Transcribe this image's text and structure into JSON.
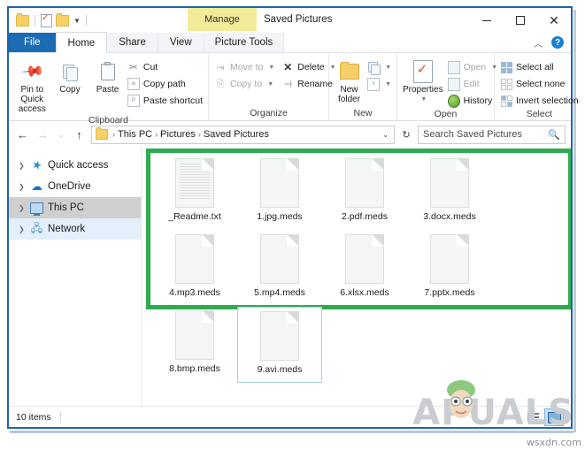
{
  "window": {
    "title": "Saved Pictures",
    "manage_tab": "Manage",
    "minimize_label": "—",
    "maximize_label": "□",
    "close_label": "✕",
    "collapse_ribbon_label": "︿",
    "help_label": "?"
  },
  "quick_access_toolbar": {
    "items": [
      "folder-icon",
      "properties-icon",
      "folder-icon",
      "chevron-down-icon"
    ]
  },
  "tabs": [
    {
      "label": "File",
      "type": "file"
    },
    {
      "label": "Home",
      "type": "active"
    },
    {
      "label": "Share",
      "type": "normal"
    },
    {
      "label": "View",
      "type": "normal"
    },
    {
      "label": "Picture Tools",
      "type": "context"
    }
  ],
  "ribbon": {
    "groups": [
      {
        "label": "Clipboard",
        "big_buttons": [
          {
            "label": "Pin to Quick access",
            "icon": "pin-icon"
          },
          {
            "label": "Copy",
            "icon": "copy-icon"
          },
          {
            "label": "Paste",
            "icon": "paste-icon"
          }
        ],
        "small_buttons": [
          {
            "label": "Cut",
            "icon": "scissors-icon",
            "dim": false
          },
          {
            "label": "Copy path",
            "icon": "copy-path-icon",
            "dim": false
          },
          {
            "label": "Paste shortcut",
            "icon": "paste-shortcut-icon",
            "dim": false
          }
        ]
      },
      {
        "label": "Organize",
        "small_buttons_a": [
          {
            "label": "Move to",
            "icon": "move-to-icon",
            "dim": true,
            "caret": true
          },
          {
            "label": "Copy to",
            "icon": "copy-to-icon",
            "dim": true,
            "caret": true
          }
        ],
        "small_buttons_b": [
          {
            "label": "Delete",
            "icon": "delete-icon",
            "dim": false,
            "caret": true
          },
          {
            "label": "Rename",
            "icon": "rename-icon",
            "dim": false,
            "caret": false
          }
        ]
      },
      {
        "label": "New",
        "big_buttons": [
          {
            "label": "New folder",
            "icon": "new-folder-icon"
          }
        ],
        "small_buttons": [
          {
            "label": "",
            "icon": "new-item-icon",
            "caret": true
          },
          {
            "label": "",
            "icon": "easy-access-icon",
            "caret": true
          }
        ]
      },
      {
        "label": "Open",
        "big_buttons": [
          {
            "label": "Properties",
            "icon": "properties-icon"
          }
        ],
        "small_buttons": [
          {
            "label": "Open",
            "icon": "open-icon",
            "dim": true,
            "caret": true
          },
          {
            "label": "Edit",
            "icon": "edit-icon",
            "dim": true,
            "caret": false
          },
          {
            "label": "History",
            "icon": "history-icon",
            "dim": false,
            "caret": false
          }
        ]
      },
      {
        "label": "Select",
        "small_buttons": [
          {
            "label": "Select all",
            "icon": "select-all-icon",
            "dim": false
          },
          {
            "label": "Select none",
            "icon": "select-none-icon",
            "dim": false
          },
          {
            "label": "Invert selection",
            "icon": "invert-selection-icon",
            "dim": false
          }
        ]
      }
    ]
  },
  "addressbar": {
    "back_label": "←",
    "forward_label": "→",
    "recent_label": "⌄",
    "up_label": "↑",
    "breadcrumbs": [
      "This PC",
      "Pictures",
      "Saved Pictures"
    ],
    "separator": "›",
    "dropdown_label": "⌄",
    "refresh_label": "↻",
    "search_placeholder": "Search Saved Pictures",
    "search_value": "",
    "search_icon": "🔍"
  },
  "sidebar": {
    "items": [
      {
        "label": "Quick access",
        "icon": "star-icon",
        "state": "normal"
      },
      {
        "label": "OneDrive",
        "icon": "cloud-icon",
        "state": "normal"
      },
      {
        "label": "This PC",
        "icon": "computer-icon",
        "state": "selected"
      },
      {
        "label": "Network",
        "icon": "network-icon",
        "state": "hover"
      }
    ],
    "expand_chevron": "›"
  },
  "files": [
    {
      "name": "_Readme.txt",
      "type": "text",
      "selected": false
    },
    {
      "name": "1.jpg.meds",
      "type": "blank",
      "selected": false
    },
    {
      "name": "2.pdf.meds",
      "type": "blank",
      "selected": false
    },
    {
      "name": "3.docx.meds",
      "type": "blank",
      "selected": false
    },
    {
      "name": "4.mp3.meds",
      "type": "blank",
      "selected": false
    },
    {
      "name": "5.mp4.meds",
      "type": "blank",
      "selected": false
    },
    {
      "name": "6.xlsx.meds",
      "type": "blank",
      "selected": false
    },
    {
      "name": "7.pptx.meds",
      "type": "blank",
      "selected": false
    },
    {
      "name": "8.bmp.meds",
      "type": "blank",
      "selected": false
    },
    {
      "name": "9.avi.meds",
      "type": "blank",
      "selected": true
    }
  ],
  "statusbar": {
    "item_count": "10 items",
    "view_details_icon": "details-view-icon",
    "view_icons_icon": "large-icons-view-icon"
  },
  "highlight": {
    "color": "#2eab4f"
  },
  "watermark": {
    "brand": "PUALS",
    "brand_prefix": "A",
    "source": "wsxdn.com"
  },
  "colors": {
    "window_border": "#1f65b0",
    "file_tab": "#1b6cb5",
    "manage_tab": "#f2ec9a",
    "selection": "#cfcfcf",
    "hover": "#e3effa",
    "highlight_green": "#2eab4f"
  }
}
